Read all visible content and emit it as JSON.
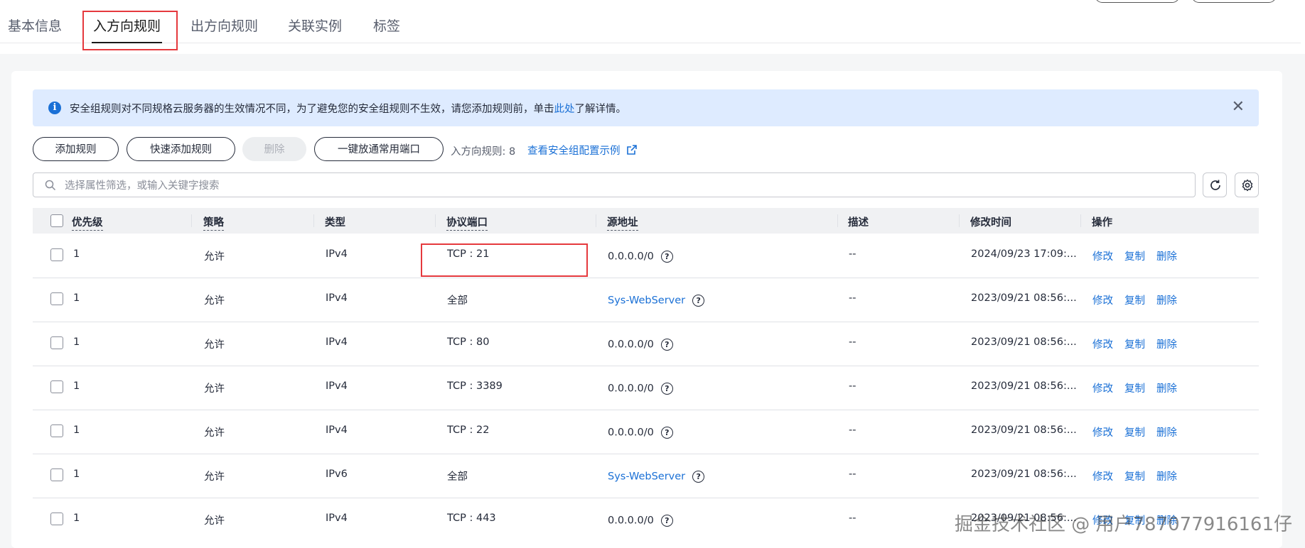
{
  "tabs": [
    "基本信息",
    "入方向规则",
    "出方向规则",
    "关联实例",
    "标签"
  ],
  "alert": {
    "text_before": "安全组规则对不同规格云服务器的生效情况不同，为了避免您的安全组规则不生效，请您添加规则前，单击",
    "link": "此处",
    "text_after": "了解详情。"
  },
  "toolbar": {
    "add_rule": "添加规则",
    "quick_add": "快速添加规则",
    "delete": "删除",
    "open_ports": "一键放通常用端口",
    "count_label": "入方向规则: 8",
    "example_link": "查看安全组配置示例"
  },
  "search": {
    "placeholder": "选择属性筛选，或输入关键字搜索"
  },
  "table": {
    "headers": [
      "优先级",
      "策略",
      "类型",
      "协议端口",
      "源地址",
      "描述",
      "修改时间",
      "操作"
    ],
    "rows": [
      {
        "priority": "1",
        "policy": "允许",
        "type": "IPv4",
        "port": "TCP : 21",
        "source": "0.0.0.0/0",
        "desc": "--",
        "time": "2024/09/23 17:09:..."
      },
      {
        "priority": "1",
        "policy": "允许",
        "type": "IPv4",
        "port": "全部",
        "source": "Sys-WebServer",
        "desc": "--",
        "time": "2023/09/21 08:56:..."
      },
      {
        "priority": "1",
        "policy": "允许",
        "type": "IPv4",
        "port": "TCP : 80",
        "source": "0.0.0.0/0",
        "desc": "--",
        "time": "2023/09/21 08:56:..."
      },
      {
        "priority": "1",
        "policy": "允许",
        "type": "IPv4",
        "port": "TCP : 3389",
        "source": "0.0.0.0/0",
        "desc": "--",
        "time": "2023/09/21 08:56:..."
      },
      {
        "priority": "1",
        "policy": "允许",
        "type": "IPv4",
        "port": "TCP : 22",
        "source": "0.0.0.0/0",
        "desc": "--",
        "time": "2023/09/21 08:56:..."
      },
      {
        "priority": "1",
        "policy": "允许",
        "type": "IPv6",
        "port": "全部",
        "source": "Sys-WebServer",
        "desc": "--",
        "time": "2023/09/21 08:56:..."
      },
      {
        "priority": "1",
        "policy": "允许",
        "type": "IPv4",
        "port": "TCP : 443",
        "source": "0.0.0.0/0",
        "desc": "--",
        "time": "2023/09/21 08:56:..."
      }
    ],
    "actions": [
      "修改",
      "复制",
      "删除"
    ]
  },
  "watermark": "掘金技术社区 @ 用户787077916161仔",
  "colors": {
    "link": "#1a70d6",
    "highlight_box": "#e5393d",
    "alert_bg": "#deebff"
  }
}
